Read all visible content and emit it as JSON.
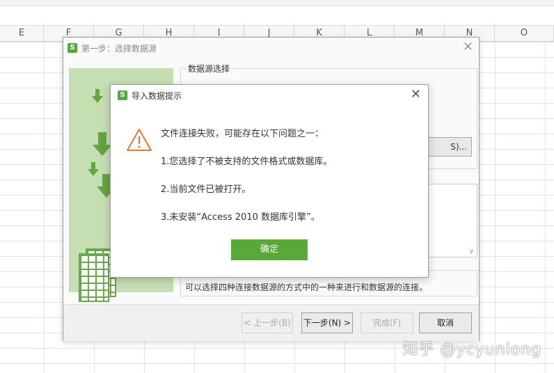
{
  "spreadsheet": {
    "columns": [
      "E",
      "F",
      "G",
      "H",
      "I",
      "J",
      "K",
      "L",
      "M",
      "N",
      "O"
    ]
  },
  "wizard": {
    "title": "第一步：选择数据源",
    "datasource_group_label": "数据源选择",
    "browse_button_label": "S)...",
    "description": "可以选择四种连接数据源的方式中的一种来进行和数据源的连接。",
    "buttons": {
      "prev": "< 上一步(B)",
      "next": "下一步(N) >",
      "finish": "完成(F)",
      "cancel": "取消"
    }
  },
  "error_dialog": {
    "title": "导入数据提示",
    "messages": [
      "文件连接失败，可能存在以下问题之一：",
      "1.您选择了不被支持的文件格式或数据库。",
      "2.当前文件已被打开。",
      "3.未安装“Access 2010 数据库引擎”。"
    ],
    "ok_label": "确定"
  },
  "watermark": "知乎 @ycyunlong",
  "colors": {
    "accent_green": "#5aa838",
    "illustration_bg": "#c6dfb2",
    "warning_orange": "#e07a2a"
  }
}
